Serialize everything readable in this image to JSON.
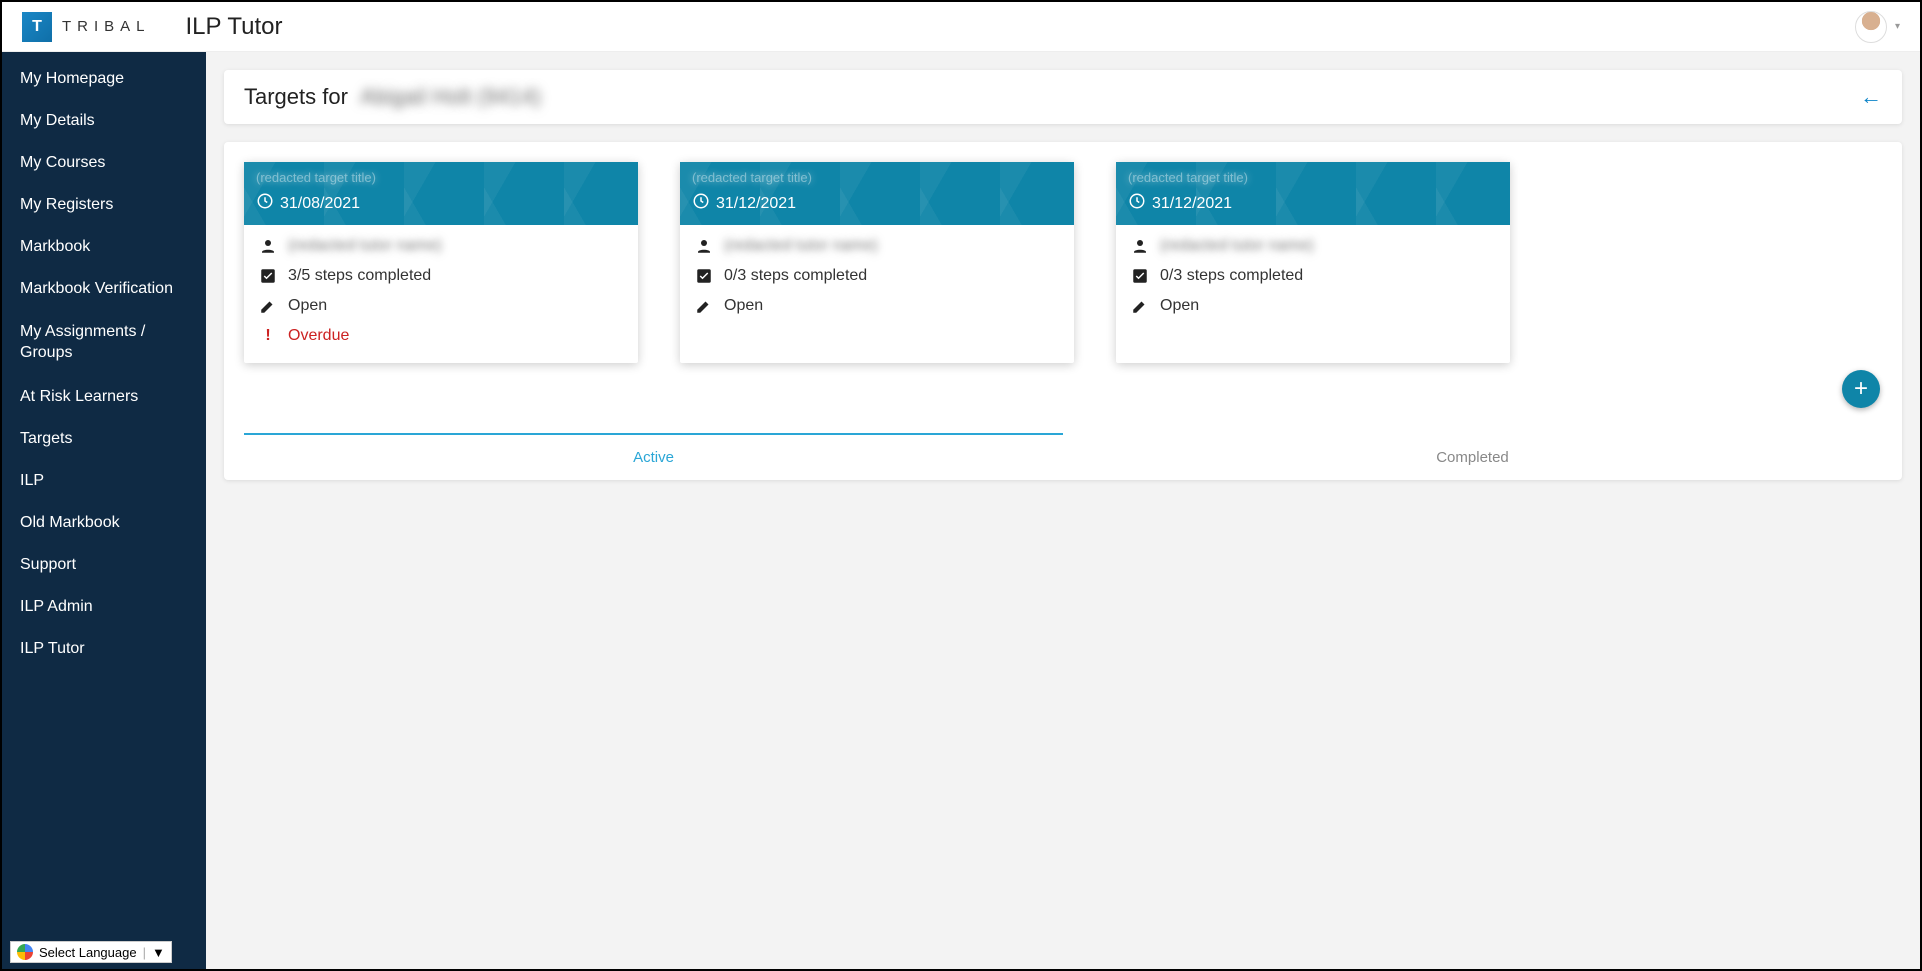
{
  "header": {
    "logo_letter": "T",
    "brand": "TRIBAL",
    "app_title": "ILP Tutor"
  },
  "sidebar": {
    "items": [
      "My Homepage",
      "My Details",
      "My Courses",
      "My Registers",
      "Markbook",
      "Markbook Verification",
      "My Assignments / Groups",
      "At Risk Learners",
      "Targets",
      "ILP",
      "Old Markbook",
      "Support",
      "ILP Admin",
      "ILP Tutor"
    ]
  },
  "page": {
    "title_prefix": "Targets for",
    "title_name": "Abigail Holt (9414)"
  },
  "cards": [
    {
      "title": "(redacted target title)",
      "date": "31/08/2021",
      "person": "(redacted tutor name)",
      "steps": "3/5 steps completed",
      "status": "Open",
      "overdue": "Overdue"
    },
    {
      "title": "(redacted target title)",
      "date": "31/12/2021",
      "person": "(redacted tutor name)",
      "steps": "0/3 steps completed",
      "status": "Open",
      "overdue": null
    },
    {
      "title": "(redacted target title)",
      "date": "31/12/2021",
      "person": "(redacted tutor name)",
      "steps": "0/3 steps completed",
      "status": "Open",
      "overdue": null
    }
  ],
  "tabs": {
    "active": "Active",
    "completed": "Completed"
  },
  "lang": {
    "label": "Select Language",
    "caret": "▼"
  }
}
